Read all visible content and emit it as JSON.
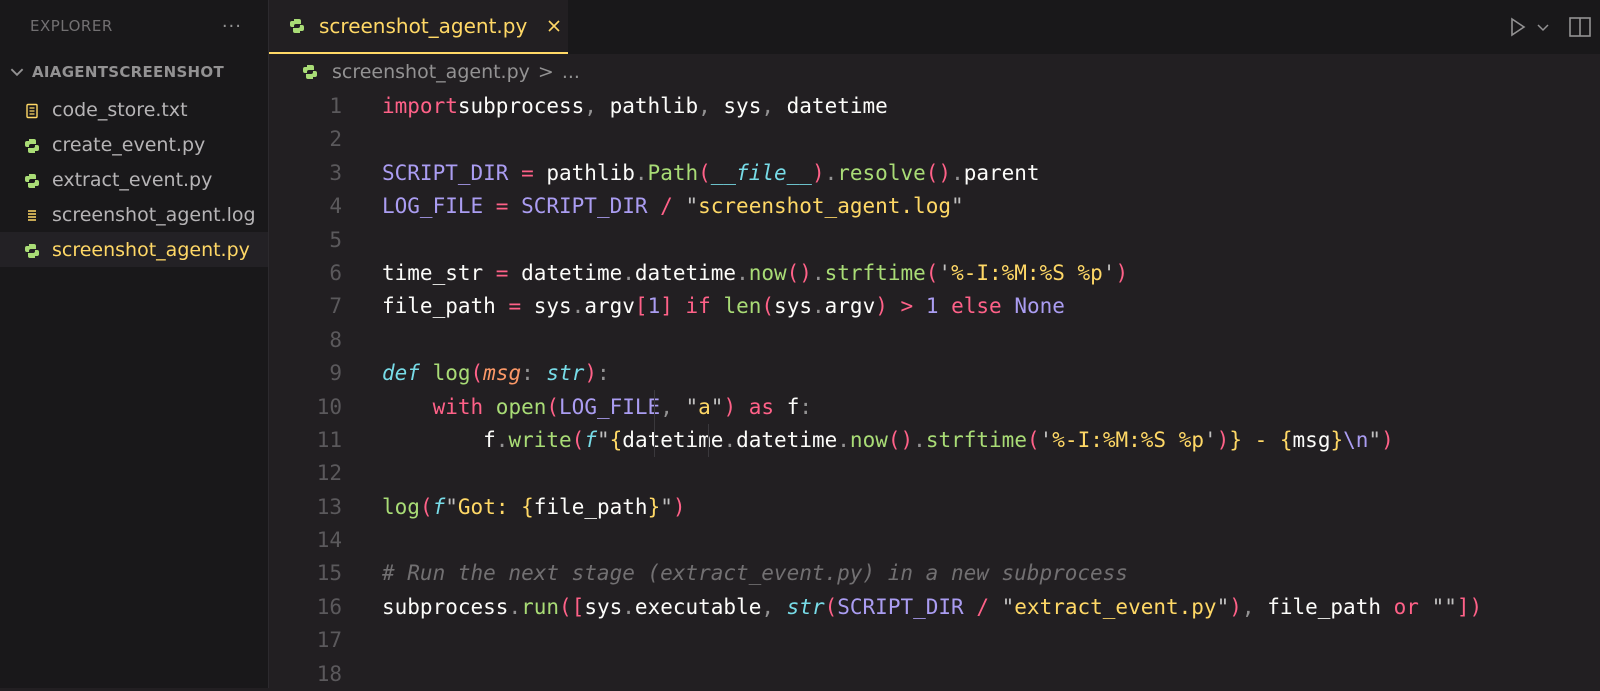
{
  "sidebar": {
    "title": "EXPLORER",
    "more": "···",
    "folder": "AIAGENTSCREENSHOT",
    "files": [
      {
        "name": "code_store.txt",
        "type": "txt"
      },
      {
        "name": "create_event.py",
        "type": "py"
      },
      {
        "name": "extract_event.py",
        "type": "py"
      },
      {
        "name": "screenshot_agent.log",
        "type": "log"
      },
      {
        "name": "screenshot_agent.py",
        "type": "py",
        "active": true
      }
    ]
  },
  "tab": {
    "label": "screenshot_agent.py"
  },
  "breadcrumb": {
    "file": "screenshot_agent.py",
    "sep": ">",
    "more": "..."
  },
  "editor": {
    "line_numbers": [
      "1",
      "2",
      "3",
      "4",
      "5",
      "6",
      "7",
      "8",
      "9",
      "10",
      "11",
      "12",
      "13",
      "14",
      "15",
      "16",
      "17",
      "18"
    ],
    "lines": [
      [
        [
          "k",
          "import"
        ],
        [
          "",
          "subprocess"
        ],
        [
          "d",
          ","
        ],
        [
          "",
          " pathlib"
        ],
        [
          "d",
          ","
        ],
        [
          "",
          " sys"
        ],
        [
          "d",
          ","
        ],
        [
          "",
          " datetime"
        ]
      ],
      [],
      [
        [
          "n",
          "SCRIPT_DIR"
        ],
        [
          "k",
          " ="
        ],
        [
          "",
          " pathlib"
        ],
        [
          "d",
          "."
        ],
        [
          "f",
          "Path"
        ],
        [
          "k",
          "("
        ],
        [
          "t",
          "__file__"
        ],
        [
          "k",
          ")"
        ],
        [
          "d",
          "."
        ],
        [
          "f",
          "resolve"
        ],
        [
          "k",
          "()"
        ],
        [
          "d",
          "."
        ],
        [
          "",
          "parent"
        ]
      ],
      [
        [
          "n",
          "LOG_FILE"
        ],
        [
          "k",
          " ="
        ],
        [
          "n",
          " SCRIPT_DIR"
        ],
        [
          "k",
          " /"
        ],
        [
          "sq",
          " \""
        ],
        [
          "s",
          "screenshot_agent.log"
        ],
        [
          "sq",
          "\""
        ]
      ],
      [],
      [
        [
          "",
          "time_str"
        ],
        [
          "k",
          " ="
        ],
        [
          "",
          " datetime"
        ],
        [
          "d",
          "."
        ],
        [
          "",
          "datetime"
        ],
        [
          "d",
          "."
        ],
        [
          "f",
          "now"
        ],
        [
          "k",
          "()"
        ],
        [
          "d",
          "."
        ],
        [
          "f",
          "strftime"
        ],
        [
          "k",
          "("
        ],
        [
          "sq",
          "'"
        ],
        [
          "s",
          "%-I:%M:%S %p"
        ],
        [
          "sq",
          "'"
        ],
        [
          "k",
          ")"
        ]
      ],
      [
        [
          "",
          "file_path"
        ],
        [
          "k",
          " ="
        ],
        [
          "",
          " sys"
        ],
        [
          "d",
          "."
        ],
        [
          "",
          "argv"
        ],
        [
          "k",
          "["
        ],
        [
          "n",
          "1"
        ],
        [
          "k",
          "]"
        ],
        [
          "k",
          " if"
        ],
        [
          "f",
          " len"
        ],
        [
          "k",
          "("
        ],
        [
          "",
          "sys"
        ],
        [
          "d",
          "."
        ],
        [
          "",
          "argv"
        ],
        [
          "k",
          ")"
        ],
        [
          "k",
          " >"
        ],
        [
          "n",
          " 1"
        ],
        [
          "k",
          " else"
        ],
        [
          "n",
          " None"
        ]
      ],
      [],
      [
        [
          "t",
          "def"
        ],
        [
          "f",
          " log"
        ],
        [
          "k",
          "("
        ],
        [
          "p",
          "msg"
        ],
        [
          "d",
          ":"
        ],
        [
          "t",
          " str"
        ],
        [
          "k",
          ")"
        ],
        [
          "d",
          ":"
        ]
      ],
      [
        [
          "",
          "    "
        ],
        [
          "k",
          "with"
        ],
        [
          "f",
          " open"
        ],
        [
          "k",
          "("
        ],
        [
          "n",
          "LOG_FILE"
        ],
        [
          "d",
          ","
        ],
        [
          "sq",
          " \""
        ],
        [
          "s",
          "a"
        ],
        [
          "sq",
          "\""
        ],
        [
          "k",
          ")"
        ],
        [
          "k",
          " as"
        ],
        [
          "",
          " f"
        ],
        [
          "d",
          ":"
        ]
      ],
      [
        [
          "",
          "        f"
        ],
        [
          "d",
          "."
        ],
        [
          "f",
          "write"
        ],
        [
          "k",
          "("
        ],
        [
          "t",
          "f"
        ],
        [
          "sq",
          "\""
        ],
        [
          "s",
          "{"
        ],
        [
          "",
          "datetime"
        ],
        [
          "d",
          "."
        ],
        [
          "",
          "datetime"
        ],
        [
          "d",
          "."
        ],
        [
          "f",
          "now"
        ],
        [
          "k",
          "()"
        ],
        [
          "d",
          "."
        ],
        [
          "f",
          "strftime"
        ],
        [
          "k",
          "("
        ],
        [
          "sq",
          "'"
        ],
        [
          "s",
          "%-I:%M:%S %p"
        ],
        [
          "sq",
          "'"
        ],
        [
          "k",
          ")"
        ],
        [
          "s",
          "} - {"
        ],
        [
          "",
          "msg"
        ],
        [
          "s",
          "}"
        ],
        [
          "n",
          "\\n"
        ],
        [
          "sq",
          "\""
        ],
        [
          "k",
          ")"
        ]
      ],
      [],
      [
        [
          "f",
          "log"
        ],
        [
          "k",
          "("
        ],
        [
          "t",
          "f"
        ],
        [
          "sq",
          "\""
        ],
        [
          "s",
          "Got: {"
        ],
        [
          "",
          "file_path"
        ],
        [
          "s",
          "}"
        ],
        [
          "sq",
          "\""
        ],
        [
          "k",
          ")"
        ]
      ],
      [],
      [
        [
          "c",
          "# Run the next stage (extract_event.py) in a new subprocess"
        ]
      ],
      [
        [
          "",
          "subprocess"
        ],
        [
          "d",
          "."
        ],
        [
          "f",
          "run"
        ],
        [
          "k",
          "(["
        ],
        [
          "",
          "sys"
        ],
        [
          "d",
          "."
        ],
        [
          "",
          "executable"
        ],
        [
          "d",
          ","
        ],
        [
          "t",
          " str"
        ],
        [
          "k",
          "("
        ],
        [
          "n",
          "SCRIPT_DIR"
        ],
        [
          "k",
          " /"
        ],
        [
          "sq",
          " \""
        ],
        [
          "s",
          "extract_event.py"
        ],
        [
          "sq",
          "\""
        ],
        [
          "k",
          ")"
        ],
        [
          "d",
          ","
        ],
        [
          "",
          " file_path"
        ],
        [
          "k",
          " or"
        ],
        [
          "sq",
          " \"\""
        ],
        [
          "k",
          "])"
        ]
      ],
      [],
      []
    ]
  },
  "colors": {
    "accent": "#ffd866",
    "background": "#221f22",
    "sidebar": "#19181a"
  },
  "icons": {
    "run": "play-icon",
    "dropdown": "chevron-down-icon",
    "split": "split-editor-icon",
    "close": "close-icon"
  }
}
